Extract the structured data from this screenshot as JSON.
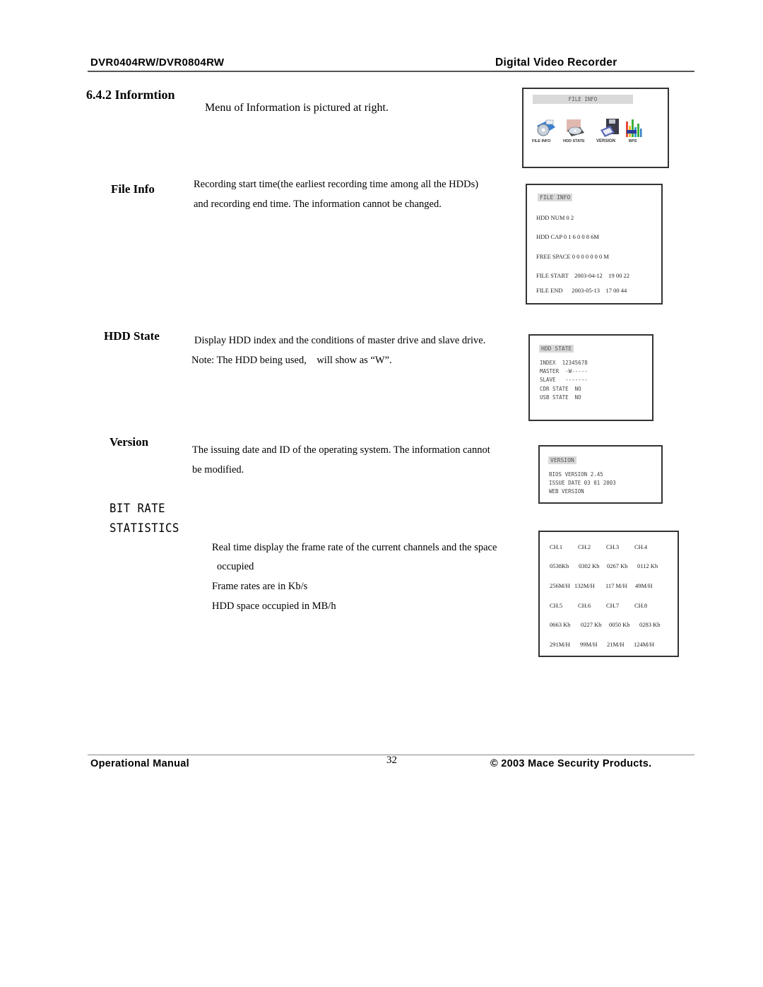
{
  "header": {
    "model": "DVR0404RW/DVR0804RW",
    "product": "Digital Video Recorder"
  },
  "section": {
    "title": "6.4.2 Informtion",
    "intro": "Menu of Information is pictured at right."
  },
  "menu_screen": {
    "title": "FILE INFO",
    "icons": [
      {
        "label": "FILE INFO",
        "icon": "disc-folder-icon"
      },
      {
        "label": "HDD STATE",
        "icon": "hard-drive-icon"
      },
      {
        "label": "VERSION",
        "icon": "floppy-disk-icon"
      },
      {
        "label": "BPS",
        "icon": "bar-meter-icon"
      }
    ]
  },
  "file_info": {
    "heading": "File Info",
    "text_line1": "Recording start time(the earliest recording time among all the HDDs)",
    "text_line2": "and recording end time. The information cannot be changed.",
    "screen": {
      "title": "FILE INFO",
      "hdd_num": "HDD NUM 0 2",
      "hdd_cap": "HDD CAP 0 1 6 0 0 8 6M",
      "free_space": "FREE SPACE 0 0 0 0 0 0 0 M",
      "file_start": "FILE START    2003-04-12    19 00 22",
      "file_end": "FILE END      2003-05-13    17 00 44"
    }
  },
  "hdd_state": {
    "heading": "HDD State",
    "text_line1": "Display HDD index and the conditions of master drive and slave drive.",
    "text_line2": "Note: The HDD being used,    will show as “W”.",
    "screen": {
      "title": "HDD STATE",
      "lines": [
        "INDEX  12345678",
        "MASTER  -W-----",
        "SLAVE   -------",
        "CDR STATE  NO",
        "USB STATE  NO"
      ]
    }
  },
  "version": {
    "heading": "Version",
    "text_line1": "The issuing date and ID of the operating system. The information cannot",
    "text_line2": "be modified.",
    "screen": {
      "title": "VERSION",
      "lines": [
        "BIOS VERSION 2.45",
        "ISSUE DATE 03 01 2003",
        "WEB VERSION"
      ]
    }
  },
  "bit_rate": {
    "heading_line1": "BIT RATE",
    "heading_line2": "STATISTICS",
    "text_line1": "Real time display the frame rate of the current channels and the space",
    "text_line2": "occupied",
    "text_line3": "Frame rates are in Kb/s",
    "text_line4": "HDD space occupied in MB/h",
    "screen": {
      "rows": [
        [
          "CH.1",
          "CH.2",
          "CH.3",
          "CH.4"
        ],
        [
          "0538Kb",
          "0302 Kb",
          "0267 Kb",
          "0112 Kb"
        ],
        [
          "256M/H",
          "132M/H",
          "117 M/H",
          "49M/H"
        ],
        [
          "CH.5",
          "CH.6",
          "CH.7",
          "CH.8"
        ],
        [
          "0663 Kb",
          "0227 Kb",
          "0050 Kb",
          "0283 Kb"
        ],
        [
          "291M/H",
          "99M/H",
          "21M/H",
          "124M/H"
        ]
      ]
    }
  },
  "footer": {
    "left": "Operational Manual",
    "page_number": "32",
    "right": "© 2003 Mace Security Products."
  }
}
